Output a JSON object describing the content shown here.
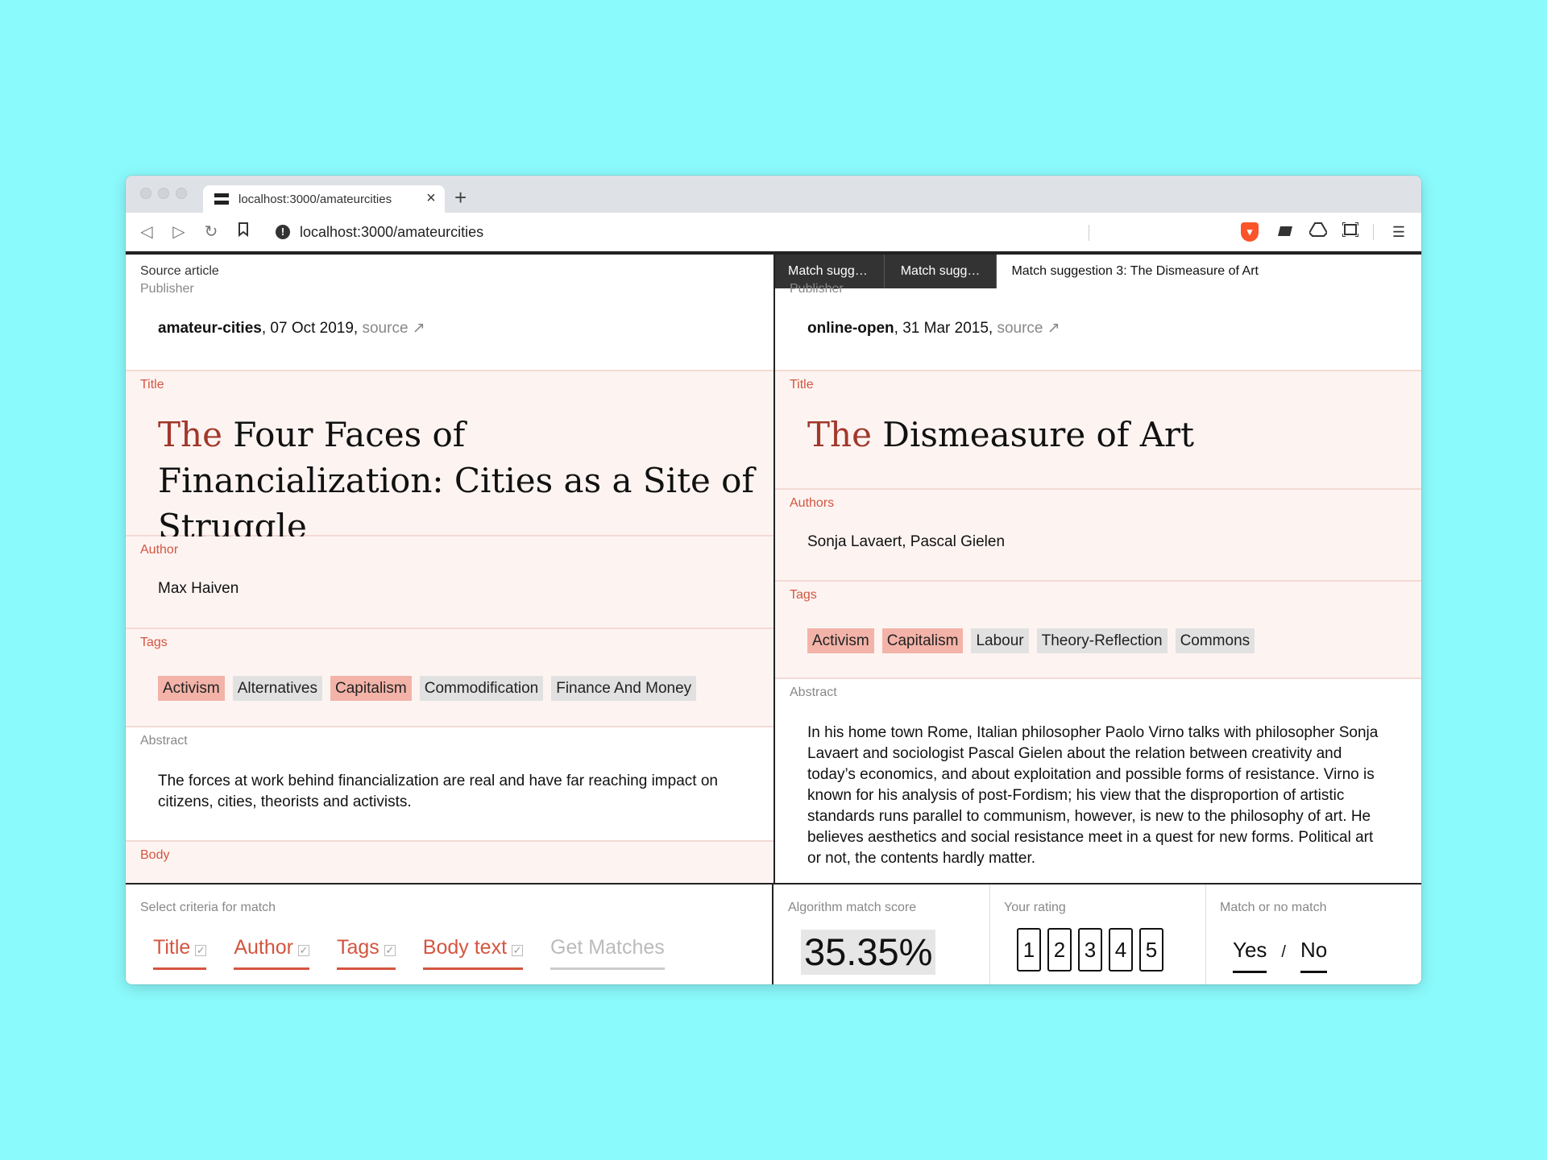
{
  "browser": {
    "tab_title": "localhost:3000/amateurcities",
    "url": "localhost:3000/amateurcities"
  },
  "source": {
    "header": "Source article",
    "publisher_label": "Publisher",
    "publisher_name": "amateur-cities",
    "publisher_date": ", 07 Oct 2019, ",
    "source_link": "source ↗",
    "title_label": "Title",
    "title_the": "The",
    "title_rest": " Four Faces of Financialization: Cities as a Site of Struggle",
    "author_label": "Author",
    "author": "Max Haiven",
    "tags_label": "Tags",
    "tags": [
      {
        "label": "Activism",
        "match": true
      },
      {
        "label": "Alternatives",
        "match": false
      },
      {
        "label": "Capitalism",
        "match": true
      },
      {
        "label": "Commodification",
        "match": false
      },
      {
        "label": "Finance And Money",
        "match": false
      }
    ],
    "abstract_label": "Abstract",
    "abstract": "The forces at work behind financialization are real and have far reaching impact on citizens, cities, theorists and activists.",
    "body_label": "Body"
  },
  "match": {
    "tabs": [
      {
        "label": "Match sugg…",
        "active": false
      },
      {
        "label": "Match sugg…",
        "active": false
      },
      {
        "label": "Match suggestion 3: The Dismeasure of Art",
        "active": true
      }
    ],
    "publisher_label": "Publisher",
    "publisher_name": "online-open",
    "publisher_date": ", 31 Mar 2015, ",
    "source_link": "source ↗",
    "title_label": "Title",
    "title_the": "The",
    "title_rest": " Dismeasure of Art",
    "authors_label": "Authors",
    "authors": "Sonja Lavaert, Pascal Gielen",
    "tags_label": "Tags",
    "tags": [
      {
        "label": "Activism",
        "match": true
      },
      {
        "label": "Capitalism",
        "match": true
      },
      {
        "label": "Labour",
        "match": false
      },
      {
        "label": "Theory-Reflection",
        "match": false
      },
      {
        "label": "Commons",
        "match": false
      }
    ],
    "abstract_label": "Abstract",
    "abstract": "In his home town Rome, Italian philosopher Paolo Virno talks with philosopher Sonja Lavaert and sociologist Pascal Gielen about the relation between creativity and today’s economics, and about exploitation and possible forms of resistance. Virno is known for his analysis of post-Fordism; his view that the disproportion of artistic standards runs parallel to communism, however, is new to the philosophy of art. He believes aesthetics and social resistance meet in a quest for new forms. Political art or not, the contents hardly matter."
  },
  "bottom": {
    "criteria_label": "Select criteria for match",
    "criteria": [
      {
        "label": "Title",
        "checked": true
      },
      {
        "label": "Author",
        "checked": true
      },
      {
        "label": "Tags",
        "checked": true
      },
      {
        "label": "Body text",
        "checked": true
      }
    ],
    "get_matches": "Get Matches",
    "score_label": "Algorithm match score",
    "score": "35.35%",
    "rating_label": "Your rating",
    "ratings": [
      "1",
      "2",
      "3",
      "4",
      "5"
    ],
    "match_label": "Match or no match",
    "yes": "Yes",
    "slash": "/",
    "no": "No"
  },
  "colors": {
    "background": "#8bfafc",
    "accent": "#d4553f",
    "title_the": "#a1382a",
    "tag_match": "#f3b3a8",
    "tag_default": "#e1e1e1",
    "section_pink": "#fdf4f2"
  }
}
